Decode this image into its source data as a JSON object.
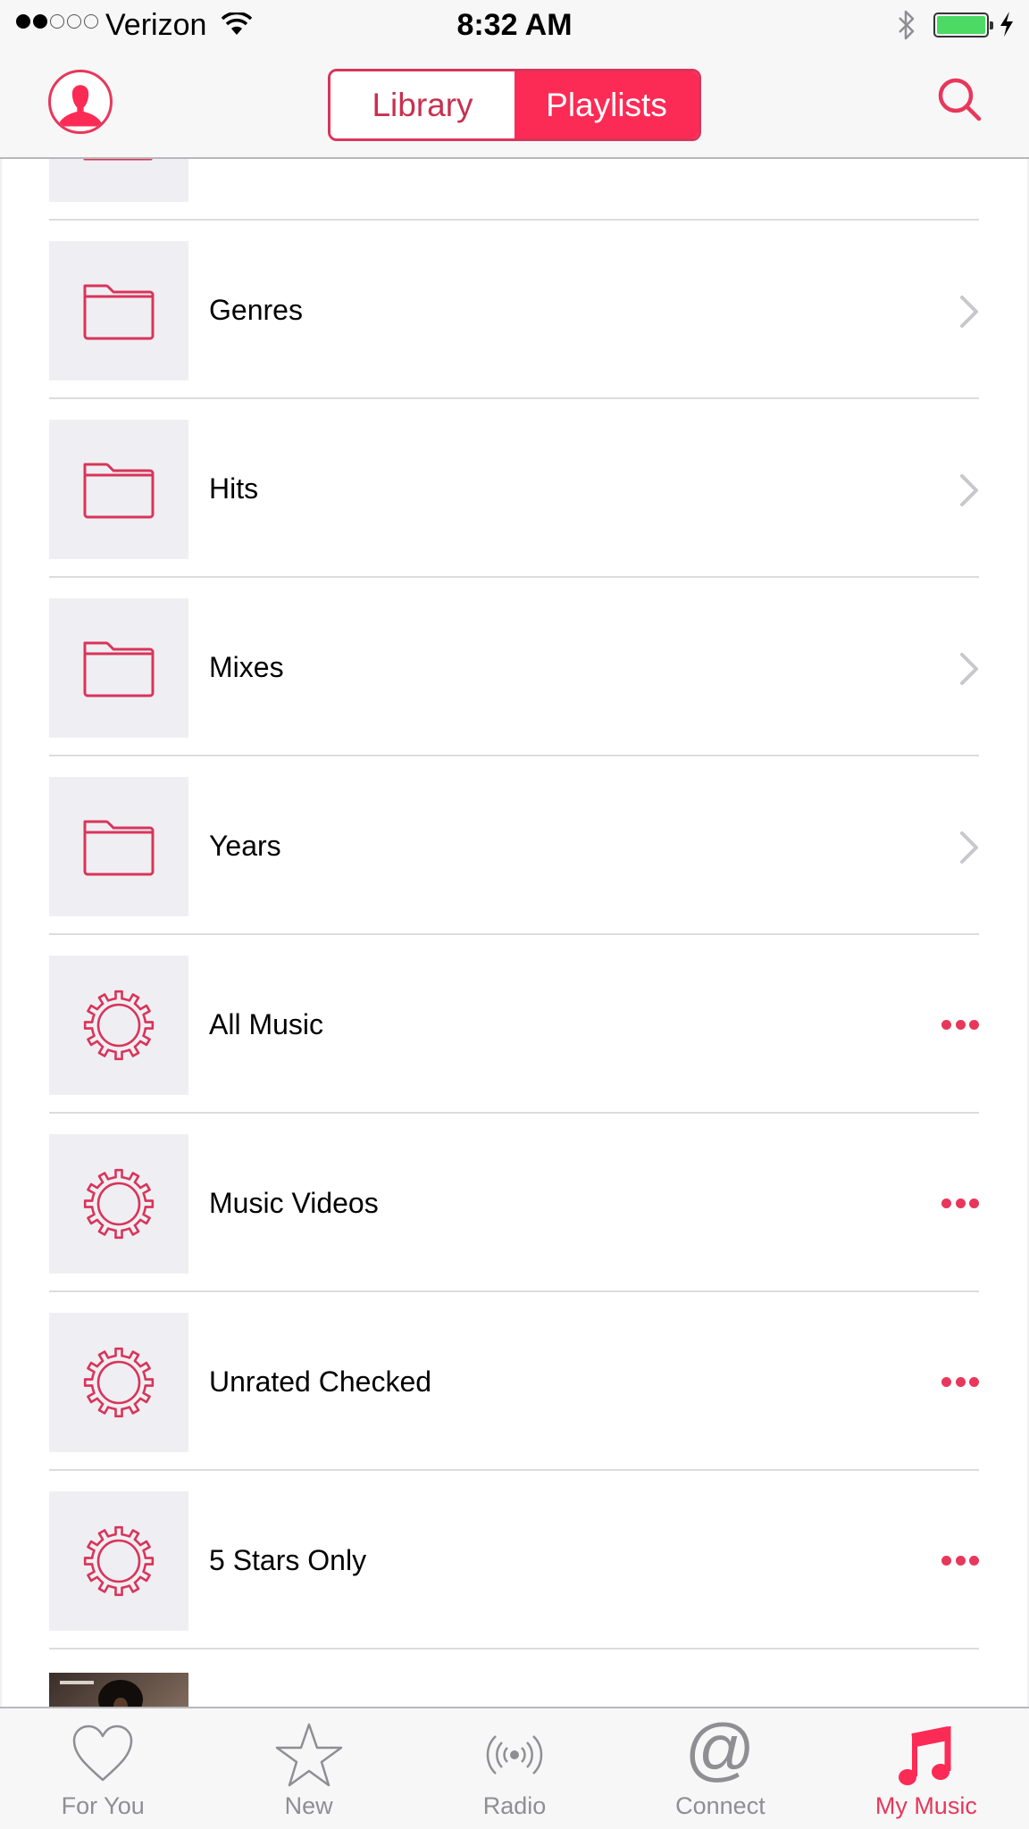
{
  "status_bar": {
    "signal_strength": "2 of 5",
    "carrier": "Verizon",
    "time": "8:32 AM",
    "bluetooth": "on",
    "battery": "charging",
    "battery_level": 1.0
  },
  "nav": {
    "segments": [
      {
        "label": "Library",
        "selected": false
      },
      {
        "label": "Playlists",
        "selected": true
      }
    ],
    "profile_icon": "profile-icon",
    "search_icon": "search-icon"
  },
  "colors": {
    "accent": "#fc2b55",
    "accent_text": "#e8375a",
    "thumb_bg": "#efeff3",
    "inactive_tab": "#8e8e93",
    "battery": "#4cd964"
  },
  "playlists": [
    {
      "title": "",
      "type": "folder",
      "partial": true
    },
    {
      "title": "Genres",
      "type": "folder",
      "accessory": "chevron"
    },
    {
      "title": "Hits",
      "type": "folder",
      "accessory": "chevron"
    },
    {
      "title": "Mixes",
      "type": "folder",
      "accessory": "chevron"
    },
    {
      "title": "Years",
      "type": "folder",
      "accessory": "chevron"
    },
    {
      "title": "All Music",
      "type": "smart",
      "accessory": "more"
    },
    {
      "title": "Music Videos",
      "type": "smart",
      "accessory": "more"
    },
    {
      "title": "Unrated Checked",
      "type": "smart",
      "accessory": "more"
    },
    {
      "title": "5 Stars Only",
      "type": "smart",
      "accessory": "more"
    },
    {
      "title": "",
      "type": "album",
      "partial": true
    }
  ],
  "tab_bar": {
    "tabs": [
      {
        "label": "For You",
        "icon": "heart-icon",
        "active": false
      },
      {
        "label": "New",
        "icon": "star-icon",
        "active": false
      },
      {
        "label": "Radio",
        "icon": "radio-icon",
        "active": false
      },
      {
        "label": "Connect",
        "icon": "at-icon",
        "active": false
      },
      {
        "label": "My Music",
        "icon": "music-note-icon",
        "active": true
      }
    ]
  }
}
